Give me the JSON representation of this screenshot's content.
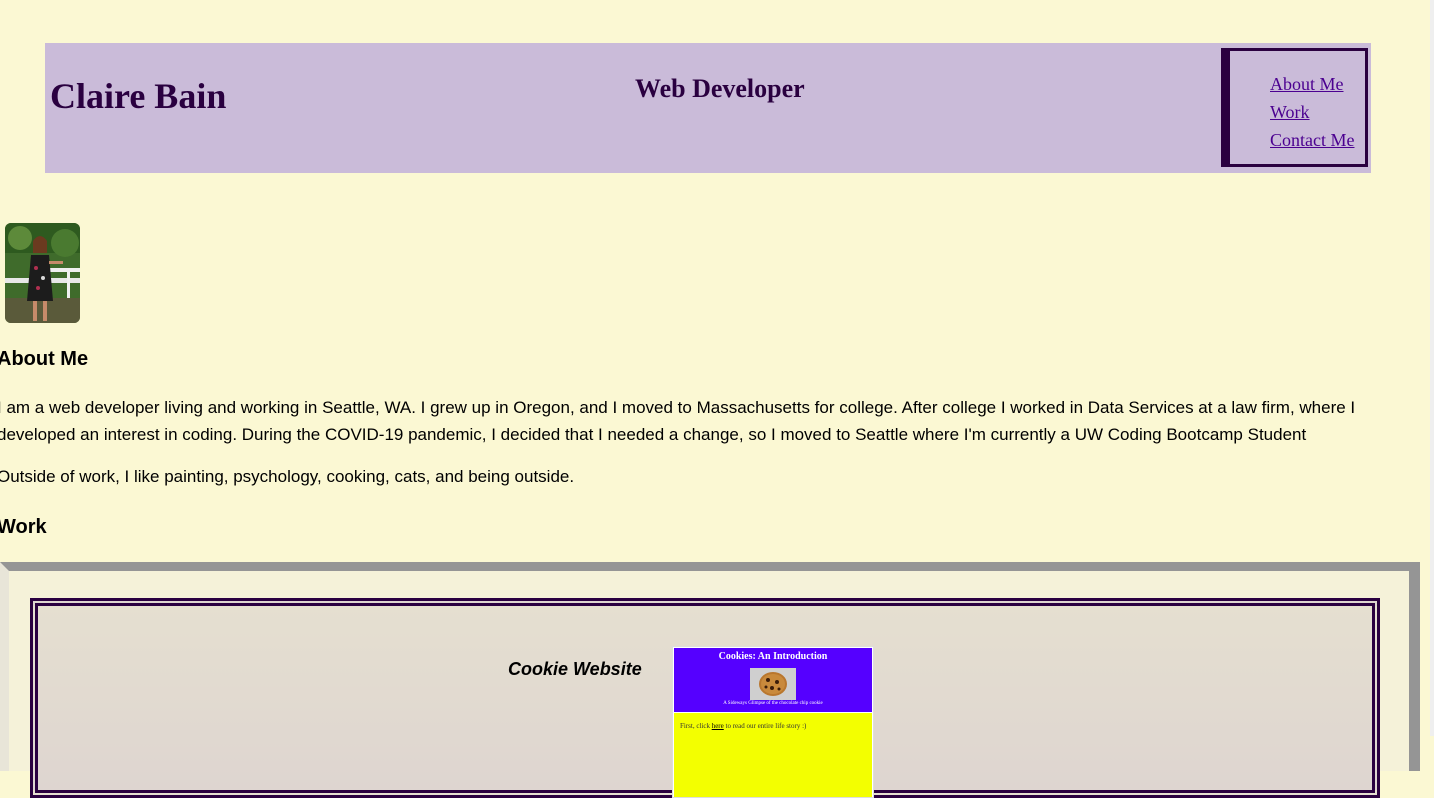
{
  "header": {
    "name": "Claire Bain",
    "role": "Web Developer",
    "nav": [
      {
        "label": "About Me"
      },
      {
        "label": "Work"
      },
      {
        "label": "Contact Me"
      }
    ]
  },
  "about": {
    "heading": "About Me",
    "paragraph1": "I am a web developer living and working in Seattle, WA. I grew up in Oregon, and I moved to Massachusetts for college. After college I worked in Data Services at a law firm, where I developed an interest in coding. During the COVID-19 pandemic, I decided that I needed a change, so I moved to Seattle where I'm currently a UW Coding Bootcamp Student",
    "paragraph2": "Outside of work, I like painting, psychology, cooking, cats, and being outside."
  },
  "work": {
    "heading": "Work",
    "projects": [
      {
        "title": "Cookie Website",
        "thumbnail": {
          "title": "Cookies: An Introduction",
          "caption": "A Sideways Glimpse of the chocolate chip cookie",
          "body_prefix": "First, click",
          "body_link": "here",
          "body_suffix": "to read our entire life story :)"
        }
      }
    ]
  },
  "colors": {
    "page_background": "#fbf8d3",
    "header_background": "#cabbd9",
    "header_text": "#2a0040",
    "nav_link": "#4b0090",
    "thumbnail_banner": "#5500ff",
    "thumbnail_body": "#f3ff00"
  }
}
